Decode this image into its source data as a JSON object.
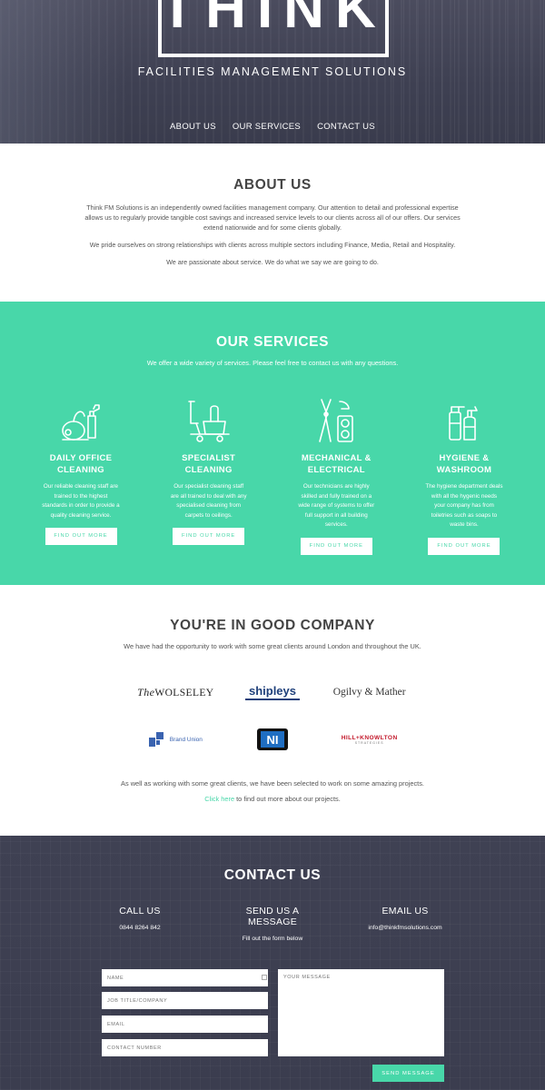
{
  "header": {
    "logo": "THINK",
    "tagline": "FACILITIES MANAGEMENT SOLUTIONS",
    "nav": [
      "ABOUT US",
      "OUR SERVICES",
      "CONTACT US"
    ]
  },
  "about": {
    "title": "ABOUT US",
    "paragraphs": [
      "Think FM Solutions is an independently owned facilities management company. Our attention to detail and professional expertise allows us to regularly provide tangible cost savings and increased service levels to our clients across all of our offers. Our services extend nationwide and for some clients globally.",
      "We pride ourselves on strong relationships with clients across multiple sectors including Finance, Media, Retail and Hospitality.",
      "We are passionate about service. We do what we say we are going to do."
    ]
  },
  "services": {
    "title": "OUR SERVICES",
    "intro": "We offer a wide variety of services. Please feel free to contact us with any questions.",
    "items": [
      {
        "icon": "vacuum-cleaner-icon",
        "title_line1": "DAILY OFFICE",
        "title_line2": "CLEANING",
        "text": "Our reliable cleaning staff are trained to the highest standards in order to provide a quality cleaning service.",
        "button": "FIND OUT MORE"
      },
      {
        "icon": "cleaning-cart-icon",
        "title_line1": "SPECIALIST",
        "title_line2": "CLEANING",
        "text": "Our specialist cleaning staff are all trained to deal with any specialised cleaning from carpets to ceilings.",
        "button": "FIND OUT MORE"
      },
      {
        "icon": "pliers-socket-icon",
        "title_line1": "MECHANICAL &",
        "title_line2": "ELECTRICAL",
        "text": "Our technicians are highly skilled and fully trained on a wide range of systems to offer full support in all building services.",
        "button": "FIND OUT MORE"
      },
      {
        "icon": "spray-bottles-icon",
        "title_line1": "HYGIENE &",
        "title_line2": "WASHROOM",
        "text": "The hygiene department deals with all the hygenic needs your company has from toiletries such as soaps to waste bins.",
        "button": "FIND OUT MORE"
      }
    ]
  },
  "company": {
    "title": "YOU'RE IN GOOD COMPANY",
    "intro": "We have had the opportunity to work with some great clients around London and throughout the UK.",
    "logos": {
      "wolseley_the": "The",
      "wolseley": "WOLSELEY",
      "shipleys": "shipleys",
      "ogilvy": "Ogilvy & Mather",
      "brandunion": "Brand Union",
      "ni": "NI",
      "hk": "HILL+KNOWLTON",
      "hk_sub": "STRATEGIES"
    },
    "more_text": "As well as working with some great clients, we have been selected to work on some amazing projects.",
    "link_text": "Click here",
    "link_suffix": " to find out more about our projects."
  },
  "contact": {
    "title": "CONTACT US",
    "columns": [
      {
        "heading": "CALL US",
        "value": "0844 8264 842"
      },
      {
        "heading": "SEND US A MESSAGE",
        "value": "Fill out the form below"
      },
      {
        "heading": "EMAIL US",
        "value": "info@thinkfmsolutions.com"
      }
    ],
    "form": {
      "name_placeholder": "NAME",
      "job_placeholder": "JOB TITLE/COMPANY",
      "email_placeholder": "EMAIL",
      "phone_placeholder": "CONTACT NUMBER",
      "message_placeholder": "YOUR MESSAGE",
      "send": "SEND MESSAGE"
    }
  },
  "colors": {
    "accent": "#48d7a9",
    "dark": "#3e4052"
  }
}
